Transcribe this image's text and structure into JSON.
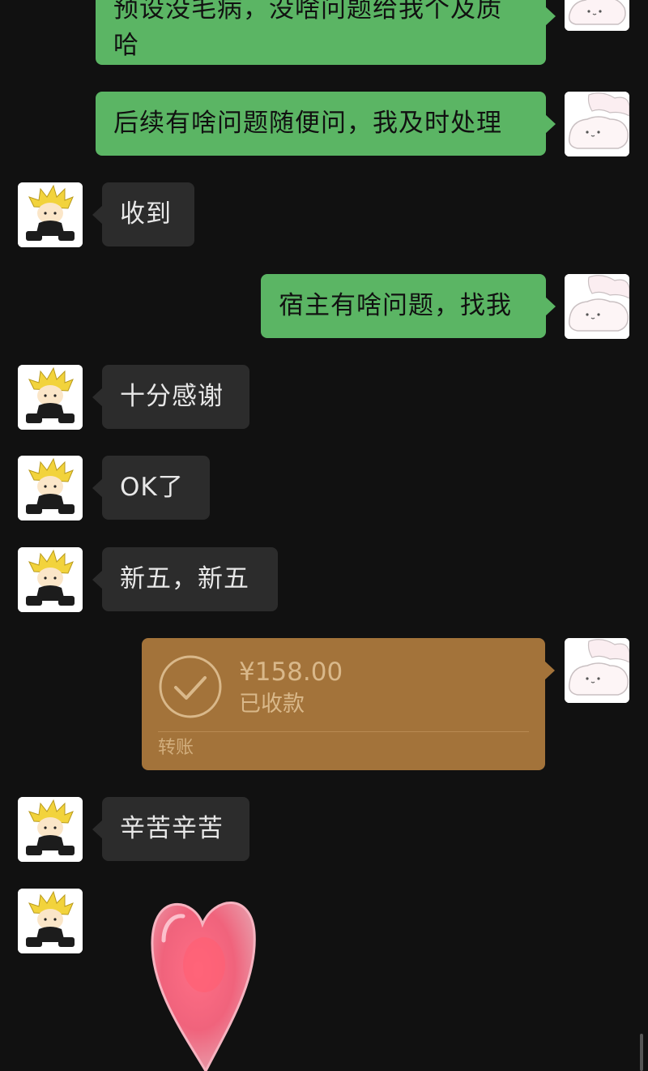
{
  "messages": {
    "m1": {
      "text_line1": "预设没毛病，没啥问题给我个及质",
      "text_line2": "哈"
    },
    "m2": {
      "text": "后续有啥问题随便问，我及时处理"
    },
    "m3": {
      "text": "收到"
    },
    "m4": {
      "text": "宿主有啥问题，找我"
    },
    "m5": {
      "text": "十分感谢"
    },
    "m6": {
      "text": "OK了"
    },
    "m7": {
      "text": "新五，新五"
    },
    "m8": {
      "amount": "¥158.00",
      "status": "已收款",
      "kind": "转账"
    },
    "m9": {
      "text": "辛苦辛苦"
    },
    "m10": {
      "sticker": "pink-heart"
    }
  },
  "colors": {
    "background": "#111111",
    "outgoing_bubble": "#5bb564",
    "incoming_bubble": "#2c2c2c",
    "transfer_card": "#a3733a"
  },
  "icons": {
    "self_avatar": "white-cat-sticker-avatar",
    "contact_avatar": "blonde-anime-character-avatar",
    "transfer_icon": "check-circle-icon"
  }
}
